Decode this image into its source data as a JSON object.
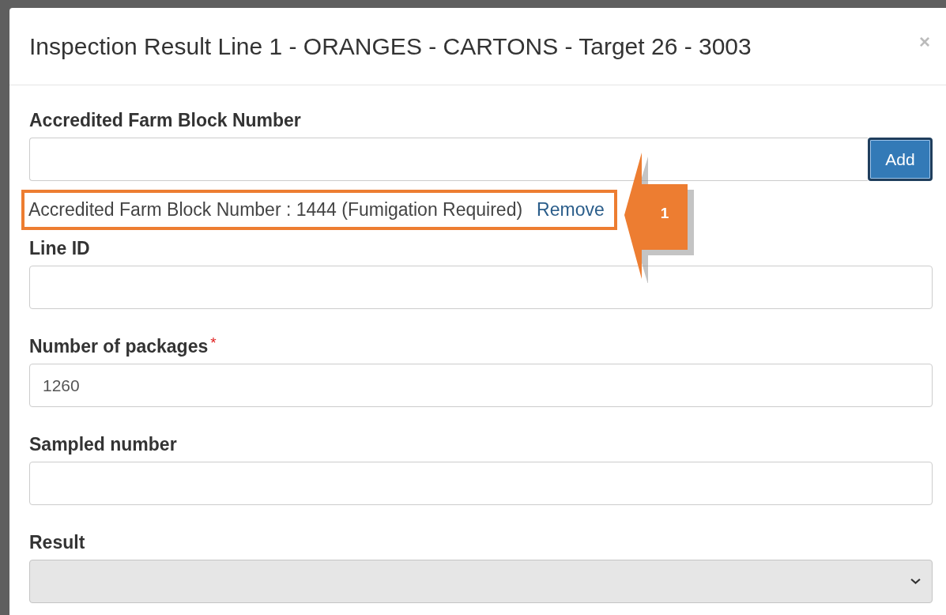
{
  "dialog": {
    "title": "Inspection Result Line 1 - ORANGES - CARTONS - Target 26 - 3003",
    "close": "×"
  },
  "fields": [
    {
      "kind": "input_with_button",
      "label": "Accredited Farm Block Number",
      "disabled": false,
      "button": "Add",
      "entries": [
        {
          "text": "Accredited Farm Block Number : 1444 (Fumigation Required)",
          "action": "Remove"
        }
      ]
    },
    {
      "kind": "input",
      "label": "Line ID",
      "disabled": false
    },
    {
      "kind": "input",
      "label": "Number of packages",
      "required_mark": "*",
      "value": "1260",
      "disabled": false
    },
    {
      "kind": "input",
      "label": "Sampled number",
      "disabled": false
    },
    {
      "kind": "select",
      "label": "Result",
      "disabled": true
    }
  ],
  "annotation": {
    "number": "1"
  }
}
